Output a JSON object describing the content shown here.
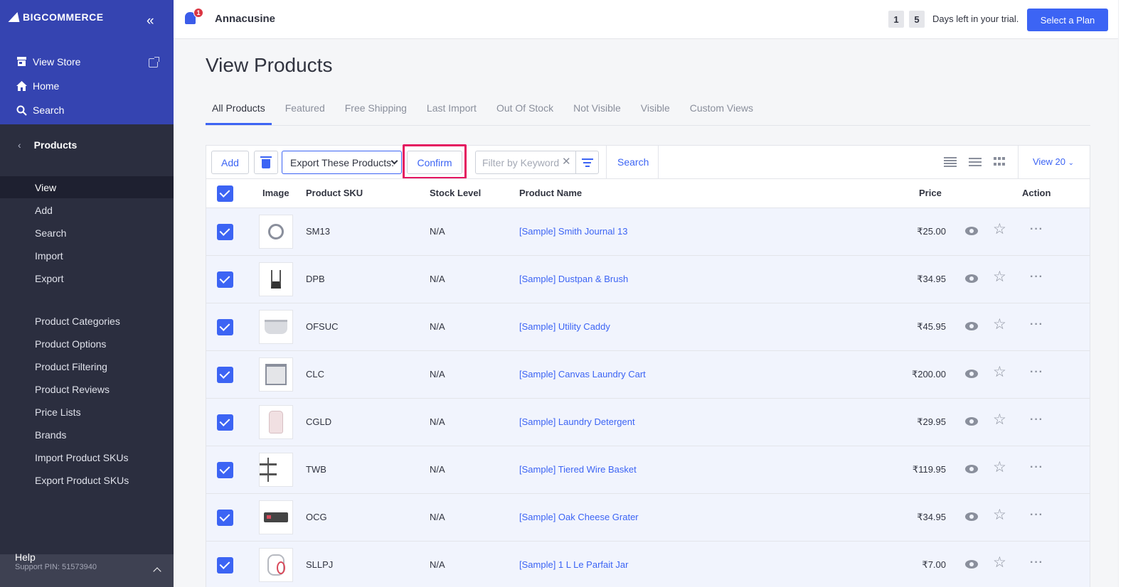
{
  "app": {
    "logo_text": "BIGCOMMERCE",
    "store_name": "Annacusine",
    "notification_count": "1"
  },
  "sidebar": {
    "top_links": [
      {
        "label": "View Store",
        "icon": "store-icon"
      },
      {
        "label": "Home",
        "icon": "home-icon"
      },
      {
        "label": "Search",
        "icon": "search-icon"
      }
    ],
    "section_title": "Products",
    "items": [
      {
        "label": "View",
        "active": true
      },
      {
        "label": "Add"
      },
      {
        "label": "Search"
      },
      {
        "label": "Import"
      },
      {
        "label": "Export"
      }
    ],
    "items2": [
      {
        "label": "Product Categories"
      },
      {
        "label": "Product Options"
      },
      {
        "label": "Product Filtering"
      },
      {
        "label": "Product Reviews"
      },
      {
        "label": "Price Lists"
      },
      {
        "label": "Brands"
      },
      {
        "label": "Import Product SKUs"
      },
      {
        "label": "Export Product SKUs"
      }
    ],
    "help_title": "Help",
    "support_pin": "Support PIN: 51573940"
  },
  "trial": {
    "digit1": "1",
    "digit2": "5",
    "text": "Days left in your trial.",
    "plan_button": "Select a Plan"
  },
  "page": {
    "title": "View Products",
    "tabs": [
      "All Products",
      "Featured",
      "Free Shipping",
      "Last Import",
      "Out Of Stock",
      "Not Visible",
      "Visible",
      "Custom Views"
    ]
  },
  "toolbar": {
    "add_label": "Add",
    "bulk_action_value": "Export These Products.",
    "confirm_label": "Confirm",
    "filter_placeholder": "Filter by Keyword",
    "search_label": "Search",
    "view_count_label": "View 20"
  },
  "table": {
    "headers": {
      "image": "Image",
      "sku": "Product SKU",
      "stock": "Stock Level",
      "name": "Product Name",
      "price": "Price",
      "action": "Action"
    },
    "rows": [
      {
        "sku": "SM13",
        "stock": "N/A",
        "name": "[Sample] Smith Journal 13",
        "price": "₹25.00"
      },
      {
        "sku": "DPB",
        "stock": "N/A",
        "name": "[Sample] Dustpan & Brush",
        "price": "₹34.95"
      },
      {
        "sku": "OFSUC",
        "stock": "N/A",
        "name": "[Sample] Utility Caddy",
        "price": "₹45.95"
      },
      {
        "sku": "CLC",
        "stock": "N/A",
        "name": "[Sample] Canvas Laundry Cart",
        "price": "₹200.00"
      },
      {
        "sku": "CGLD",
        "stock": "N/A",
        "name": "[Sample] Laundry Detergent",
        "price": "₹29.95"
      },
      {
        "sku": "TWB",
        "stock": "N/A",
        "name": "[Sample] Tiered Wire Basket",
        "price": "₹119.95"
      },
      {
        "sku": "OCG",
        "stock": "N/A",
        "name": "[Sample] Oak Cheese Grater",
        "price": "₹34.95"
      },
      {
        "sku": "SLLPJ",
        "stock": "N/A",
        "name": "[Sample] 1 L Le Parfait Jar",
        "price": "₹7.00"
      }
    ]
  },
  "colors": {
    "brand_blue": "#3c64f4",
    "sidebar_dark": "#2b2e3f",
    "sidebar_top": "#3544b1",
    "highlight": "#e4145f"
  }
}
